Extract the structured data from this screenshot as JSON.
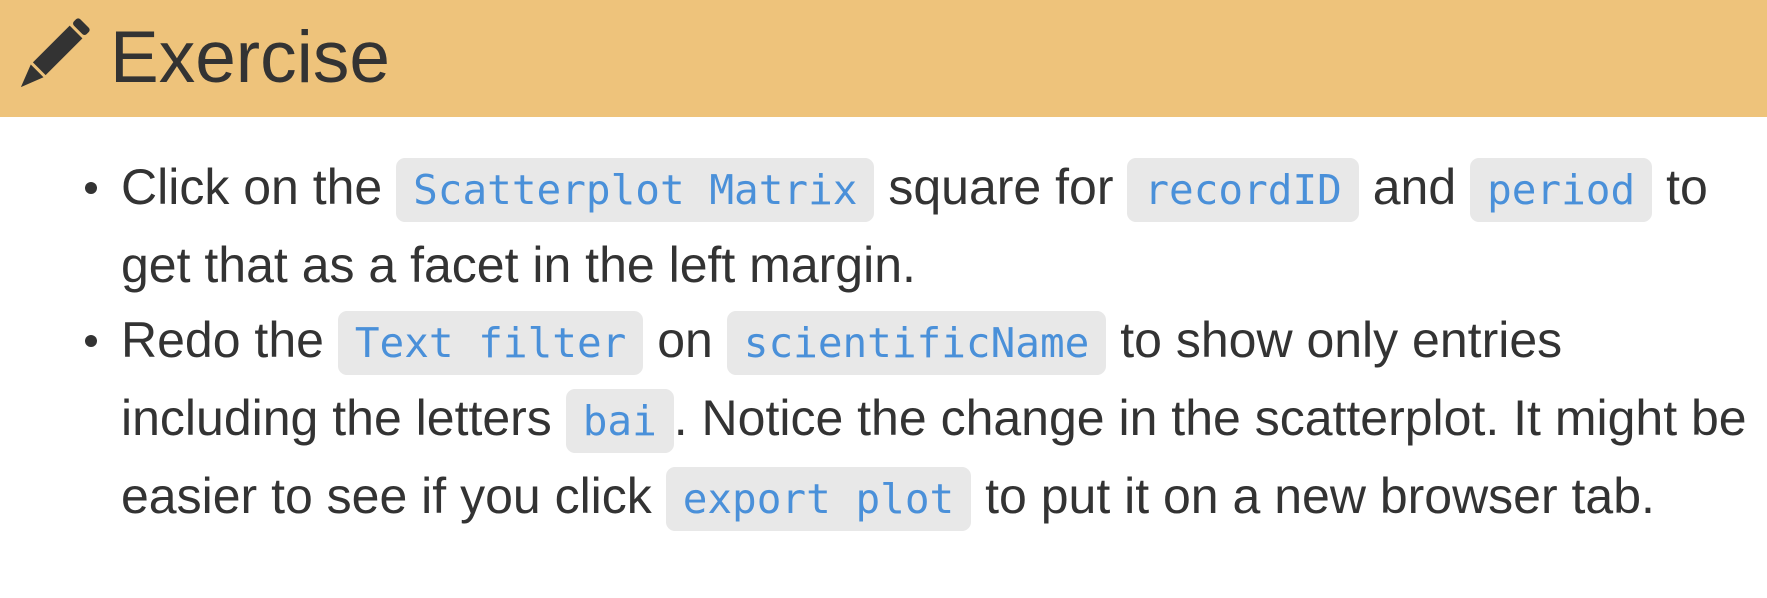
{
  "header": {
    "icon": "pencil-icon",
    "title": "Exercise",
    "background_color": "#eec37b"
  },
  "exercise": {
    "item1": {
      "t1": "Click on the ",
      "c1": "Scatterplot Matrix",
      "t2": " square for ",
      "c2": "recordID",
      "t3": " and ",
      "c3": "period",
      "t4": " to get that as a facet in the left margin."
    },
    "item2": {
      "t1": "Redo the ",
      "c1": "Text filter",
      "t2": " on ",
      "c2": "scientificName",
      "t3": " to show only entries including the letters ",
      "c3": "bai",
      "t4": ". Notice the change in the scatterplot. It might be easier to see if you click ",
      "c4": "export plot",
      "t5": " to put it on a new browser tab."
    }
  },
  "code_color": "#4a90d9",
  "code_background": "#e8e8e8"
}
